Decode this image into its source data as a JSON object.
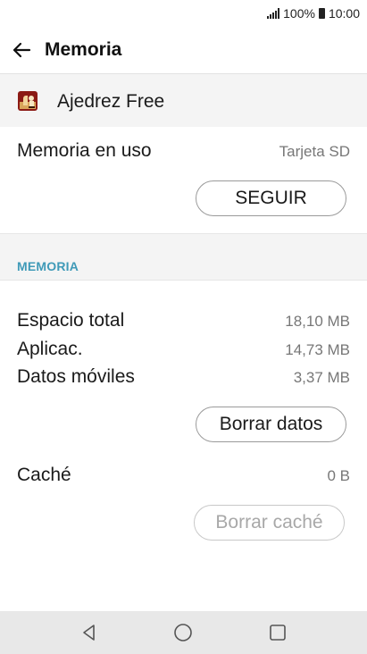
{
  "status_bar": {
    "battery_percent": "100%",
    "time": "10:00",
    "icons": [
      "signal-icon",
      "battery-icon"
    ]
  },
  "app_bar": {
    "title": "Memoria",
    "back_icon": "back-arrow-icon"
  },
  "app": {
    "name": "Ajedrez Free",
    "icon": "chess-app-icon"
  },
  "storage": {
    "label": "Memoria en uso",
    "value": "Tarjeta SD",
    "button": "SEGUIR"
  },
  "section": {
    "header": "MEMORIA"
  },
  "memory_rows": [
    {
      "label": "Espacio total",
      "value": "18,10 MB"
    },
    {
      "label": "Aplicac.",
      "value": "14,73 MB"
    },
    {
      "label": "Datos móviles",
      "value": "3,37 MB"
    }
  ],
  "clear_data_button": "Borrar datos",
  "cache": {
    "label": "Caché",
    "value": "0 B",
    "button": "Borrar caché"
  },
  "nav_bar": {
    "icons": [
      "nav-back-icon",
      "nav-home-icon",
      "nav-recents-icon"
    ]
  }
}
